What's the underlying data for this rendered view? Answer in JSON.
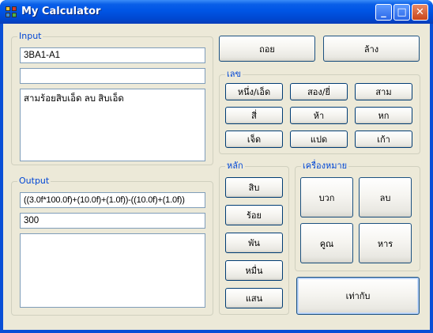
{
  "window": {
    "title": "My Calculator",
    "icon": "calculator-app-icon",
    "controls": [
      "minimize-icon",
      "maximize-icon",
      "close-icon"
    ],
    "control_glyphs": {
      "minimize": "_",
      "maximize": "□",
      "close": "✕"
    }
  },
  "input": {
    "legend": "Input",
    "expression": "3BA1-A1",
    "second_line": "",
    "text": "สามร้อยสิบเอ็ด ลบ สิบเอ็ด"
  },
  "output": {
    "legend": "Output",
    "expression": "((3.0f*100.0f)+(10.0f)+(1.0f))-((10.0f)+(1.0f))",
    "result": "300",
    "log": ""
  },
  "actions": {
    "backspace": "ถอย",
    "clear": "ล้าง",
    "equals": "เท่ากับ"
  },
  "numbers": {
    "legend": "เลข",
    "buttons": [
      "หนึ่ง/เอ็ด",
      "สอง/ยี่",
      "สาม",
      "สี่",
      "ห้า",
      "หก",
      "เจ็ด",
      "แปด",
      "เก้า"
    ]
  },
  "places": {
    "legend": "หลัก",
    "buttons": [
      "สิบ",
      "ร้อย",
      "พัน",
      "หมื่น",
      "แสน"
    ]
  },
  "operators": {
    "legend": "เครื่องหมาย",
    "plus": "บวก",
    "minus": "ลบ",
    "multiply": "คูณ",
    "divide": "หาร"
  }
}
